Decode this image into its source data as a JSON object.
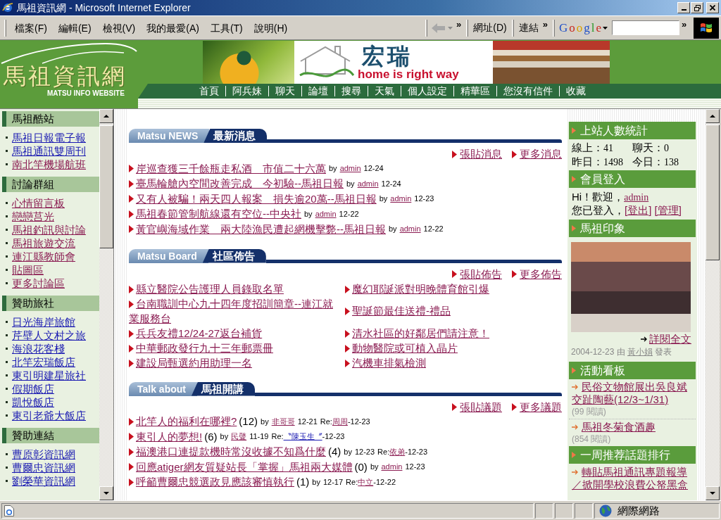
{
  "window": {
    "title": "馬祖資訊網 - Microsoft Internet Explorer"
  },
  "menu_bar": {
    "items": [
      "檔案(F)",
      "編輯(E)",
      "檢視(V)",
      "我的最愛(A)",
      "工具(T)",
      "說明(H)"
    ]
  },
  "toolbar": {
    "back_button": {
      "disabled": true
    },
    "chevrons": [
      "»",
      "»",
      "»"
    ],
    "address_label": "網址(D)",
    "links_label": "連結",
    "search_engine": "Google"
  },
  "header": {
    "logo": {
      "title": "馬祖資訊網",
      "subtitle": "MATSU INFO WEBSITE"
    },
    "banner": {
      "brand": "宏瑞",
      "slogan": "home is right way"
    },
    "nav": [
      "首頁",
      "阿兵妹",
      "聊天",
      "論壇",
      "搜尋",
      "天氣",
      "個人設定",
      "精華區",
      "您沒有信件",
      "收藏"
    ]
  },
  "sidebar": {
    "sections": [
      {
        "title": "馬祖酷站",
        "items": [
          {
            "label": "馬祖日報電子報",
            "visited": false
          },
          {
            "label": "馬祖通訊雙周刊",
            "visited": false
          },
          {
            "label": "南北竿機場航班",
            "visited": true
          }
        ]
      },
      {
        "title": "討論群組",
        "items": [
          {
            "label": "心情留言板",
            "visited": true
          },
          {
            "label": "戀戀莒光",
            "visited": true
          },
          {
            "label": "馬祖釣訊與討論",
            "visited": true
          },
          {
            "label": "馬祖旅遊交流",
            "visited": true
          },
          {
            "label": "連江縣教師會",
            "visited": true
          },
          {
            "label": "貼圖區",
            "visited": true
          },
          {
            "label": "更多討論區",
            "visited": true
          }
        ]
      },
      {
        "title": "贊助旅社",
        "items": [
          {
            "label": "日光海岸旅館",
            "visited": false
          },
          {
            "label": "芹壁人文村之旅",
            "visited": false
          },
          {
            "label": "海浪花客棧",
            "visited": false
          },
          {
            "label": "北竿宏瑞飯店",
            "visited": false
          },
          {
            "label": "東引明建星旅社",
            "visited": false
          },
          {
            "label": "假期飯店",
            "visited": false
          },
          {
            "label": "凱悅飯店",
            "visited": false
          },
          {
            "label": "東引老爺大飯店",
            "visited": false
          }
        ]
      },
      {
        "title": "贊助連結",
        "items": [
          {
            "label": "曹原彰資訊網",
            "visited": false
          },
          {
            "label": "曹爾忠資訊網",
            "visited": false
          },
          {
            "label": "劉榮華資訊網",
            "visited": false
          }
        ]
      }
    ]
  },
  "news": {
    "label": "Matsu NEWS",
    "title": "最新消息",
    "actions": [
      "張貼消息",
      "更多消息"
    ],
    "items": [
      {
        "title": "岸巡查獲三千餘瓶走私酒　市值二十六萬",
        "by": "by",
        "author": "admin",
        "date": "12-24"
      },
      {
        "title": "臺馬輪艙內空間改善完成　今初驗--馬祖日報",
        "by": "by",
        "author": "admin",
        "date": "12-24"
      },
      {
        "title": "又有人被騙！兩天四人報案　損失逾20萬--馬祖日報",
        "by": "by",
        "author": "admin",
        "date": "12-23"
      },
      {
        "title": "馬祖春節管制航線還有空位--中央社",
        "by": "by",
        "author": "admin",
        "date": "12-22"
      },
      {
        "title": "黃官嶼海域作業　兩大陸漁民遭起網機擊斃--馬祖日報",
        "by": "by",
        "author": "admin",
        "date": "12-22"
      }
    ]
  },
  "board": {
    "label": "Matsu Board",
    "title": "社區佈告",
    "actions": [
      "張貼佈告",
      "更多佈告"
    ],
    "rows": [
      [
        "縣立醫院公告護理人員錄取名單",
        "魔幻耶誕派對明晚體育館引爆"
      ],
      [
        "台南職訓中心九十四年度招訓簡章--連江就業服務台",
        "聖誕節最佳送禮-禮品"
      ],
      [
        "兵兵友禮12/24-27返台補貨",
        "清水社區的好鄰居們請注意！"
      ],
      [
        "中華郵政發行九十三年郵票冊",
        "動物醫院或可植入晶片"
      ],
      [
        "建設局甄選約用助理一名",
        "汽機車排氣檢測"
      ]
    ]
  },
  "talk": {
    "label": "Talk about",
    "title": "馬祖開講",
    "actions": [
      "張貼議題",
      "更多議題"
    ],
    "topics": [
      {
        "title": "北竿人的福利在哪裡?",
        "count": "(12)",
        "by": "by",
        "author": "非哥哥",
        "date": "12-21",
        "reply": {
          "label": "Re:",
          "author": "周周",
          "date": "-12-23",
          "visited": true
        }
      },
      {
        "title": "東引人的夢想!",
        "count": "(6)",
        "by": "by",
        "author": "民聲",
        "date": "11-19",
        "reply": {
          "label": "Re:",
          "author": "〝陳玉生〞",
          "date": "-12-23",
          "visited": false
        }
      },
      {
        "title": "福澳港口連提款機時常沒收據不知爲什麼",
        "count": "(4)",
        "by": "by",
        "date": "12-23",
        "reply": {
          "label": "Re:",
          "author": "依弟",
          "date": "-12-23",
          "visited": true
        }
      },
      {
        "title": "回應atiger網友質疑站長「掌握」馬祖兩大媒體",
        "count": "(0)",
        "by": "by",
        "author": "admin",
        "date": "12-23"
      },
      {
        "title": "呼籲曹爾忠競選政見應該審慎執行",
        "count": "(1)",
        "by": "by",
        "date": "12-17",
        "reply": {
          "label": "Re:",
          "author": "中立",
          "date": "-12-22",
          "visited": true
        }
      }
    ]
  },
  "right_panel": {
    "stats": {
      "title": "上站人數統計",
      "entries": [
        {
          "label": "線上：",
          "value": "41"
        },
        {
          "label": "聊天：",
          "value": "0"
        },
        {
          "label": "昨日：",
          "value": "1498"
        },
        {
          "label": "今日：",
          "value": "138"
        }
      ]
    },
    "login": {
      "title": "會員登入",
      "greeting": "Hi！歡迎，",
      "user": "admin",
      "status": "您已登入，",
      "links": [
        "[登出]",
        "[管理]"
      ]
    },
    "gallery": {
      "title": "馬祖印象",
      "more": "詳閱全文",
      "date": "2004-12-23",
      "by": "由",
      "author": "黃小娟",
      "posted": "發表"
    },
    "events": {
      "title": "活動看板",
      "items": [
        {
          "title": "民俗文物館展出吳良斌交趾陶藝(12/3~1/31)",
          "reads": "(99 閱讀)"
        },
        {
          "title": "馬祖冬菊食酒趣",
          "reads": "(854 閱讀)"
        }
      ]
    },
    "ranking": {
      "title": "一周推荐話題排行",
      "items": [
        "轉貼馬祖通訊專題報導／掀開學校浪費公帑黑盒"
      ]
    }
  },
  "status_bar": {
    "zone": "網際網路"
  }
}
